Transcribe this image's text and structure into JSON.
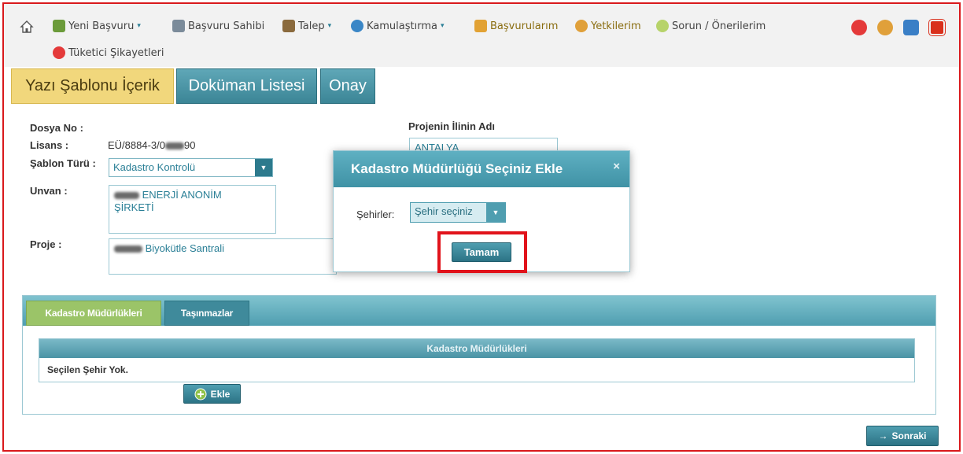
{
  "nav": {
    "items": [
      {
        "label": "Yeni Başvuru",
        "caret": "▾",
        "icon": "new-application-icon",
        "color": "#6b9b3a"
      },
      {
        "label": "Başvuru Sahibi",
        "icon": "applicant-icon",
        "color": "#7b8b9a"
      },
      {
        "label": "Talep",
        "caret": "▾",
        "icon": "request-icon",
        "color": "#8a6a3d"
      },
      {
        "label": "Kamulaştırma",
        "caret": "▾",
        "icon": "globe-icon",
        "color": "#3a86c6"
      },
      {
        "label": "Başvurularım",
        "icon": "folder-icon",
        "color": "#e2a234"
      },
      {
        "label": "Yetkilerim",
        "icon": "users-icon",
        "color": "#e0a03a"
      },
      {
        "label": "Sorun / Önerilerim",
        "icon": "speech-bubble-icon",
        "color": "#b7d36a"
      },
      {
        "label": "Tüketici Şikayetleri",
        "icon": "complaint-phone-icon",
        "color": "#e43a3a"
      }
    ],
    "right_icons": [
      {
        "icon": "notification-phone-icon",
        "color": "#e43a3a"
      },
      {
        "icon": "user-profile-icon",
        "color": "#e0a03a"
      },
      {
        "icon": "info-icon",
        "color": "#3a7fc6"
      },
      {
        "icon": "power-icon",
        "color": "#d9301c"
      }
    ]
  },
  "top_tabs": [
    "Yazı Şablonu İçerik",
    "Doküman Listesi",
    "Onay"
  ],
  "form": {
    "dosya_no_label": "Dosya No :",
    "lisans_label": "Lisans :",
    "lisans_value_prefix": "EÜ/8884-3/0",
    "lisans_value_suffix": "90",
    "sablon_turu_label": "Şablon Türü :",
    "sablon_turu_value": "Kadastro Kontrolü",
    "unvan_label": "Unvan :",
    "unvan_line1": "ENERJİ ANONİM",
    "unvan_line2": "ŞİRKETİ",
    "proje_label": "Proje :",
    "proje_value": "Biyokütle Santrali",
    "projenin_ili_label": "Projenin İlinin Adı",
    "projenin_ili_value": "ANTALYA"
  },
  "bottom_tabs": [
    "Kadastro Müdürlükleri",
    "Taşınmazlar"
  ],
  "grid": {
    "header": "Kadastro Müdürlükleri",
    "empty_text": "Seçilen Şehir Yok."
  },
  "add_button_label": "Ekle",
  "next_button_label": "Sonraki",
  "next_button_glyph": "→",
  "modal": {
    "title": "Kadastro Müdürlüğü Seçiniz Ekle",
    "close_glyph": "×",
    "sehirler_label": "Şehirler:",
    "sehir_select_value": "Şehir seçiniz",
    "ok_button_label": "Tamam"
  }
}
